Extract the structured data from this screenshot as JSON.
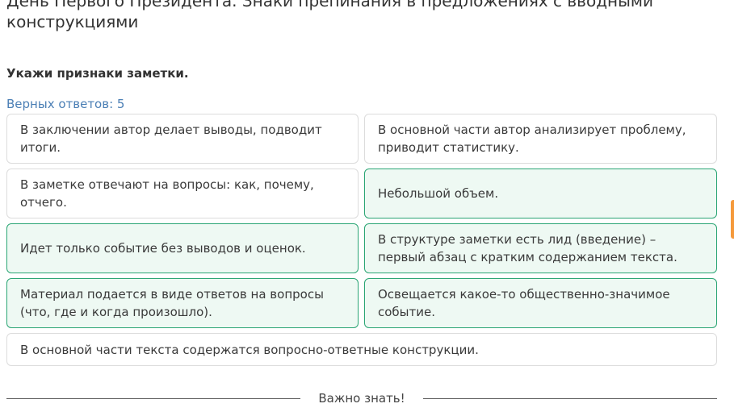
{
  "header": {
    "title": "День Первого Президента. Знаки препинания в предложениях с вводными конструкциями"
  },
  "task": {
    "question": "Укажи признаки заметки.",
    "correct_count": "Верных ответов: 5"
  },
  "options": [
    {
      "text": "В заключении автор делает выводы, подводит итоги.",
      "selected": false
    },
    {
      "text": "В основной части автор анализирует проблему, приводит статистику.",
      "selected": false
    },
    {
      "text": "В заметке отвечают на вопросы: как, почему, отчего.",
      "selected": false
    },
    {
      "text": "Небольшой объем.",
      "selected": true
    },
    {
      "text": "Идет только событие без выводов и оценок.",
      "selected": true
    },
    {
      "text": "В структуре заметки есть лид (введение) – первый абзац с кратким содержанием текста.",
      "selected": true
    },
    {
      "text": "Материал подается в виде ответов на вопросы (что, где и когда произошло).",
      "selected": true
    },
    {
      "text": "Освещается какое-то общественно-значимое событие.",
      "selected": true
    },
    {
      "text": "В основной части текста содержатся вопросно-ответные конструкции.",
      "selected": false
    }
  ],
  "footer": {
    "divider_label": "Важно знать!"
  },
  "colors": {
    "accent_green": "#2aa574",
    "selected_background": "#eef9f3",
    "counter_blue": "#4b7fb5",
    "edge_tab_orange": "#f59a3c"
  }
}
